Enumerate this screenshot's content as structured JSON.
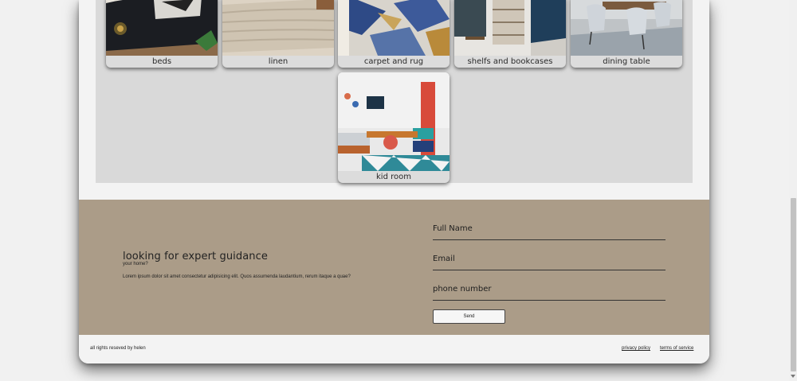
{
  "gallery": {
    "row1": [
      {
        "label": "beds"
      },
      {
        "label": "linen"
      },
      {
        "label": "carpet and rug"
      },
      {
        "label": "shelfs and bookcases"
      },
      {
        "label": "dining table"
      }
    ],
    "row2": [
      {
        "label": "kid room"
      }
    ]
  },
  "contact": {
    "title": "looking for expert guidance",
    "subtitle": "your home?",
    "description": "Lorem ipsum dolor sit amet consectetur adipisicing elit. Quos assumenda laudantium, rerum itaque a quae?",
    "fields": {
      "full_name": "Full Name",
      "email": "Email",
      "phone": "phone number"
    },
    "send_label": "Send"
  },
  "footer": {
    "rights": "all rights reseved by helen",
    "privacy": "privacy policy",
    "terms": "terms of service"
  },
  "colors": {
    "contact_bg": "#ab9c88",
    "gallery_bg": "#d9d9d9",
    "page_bg": "#f3f3f3"
  }
}
